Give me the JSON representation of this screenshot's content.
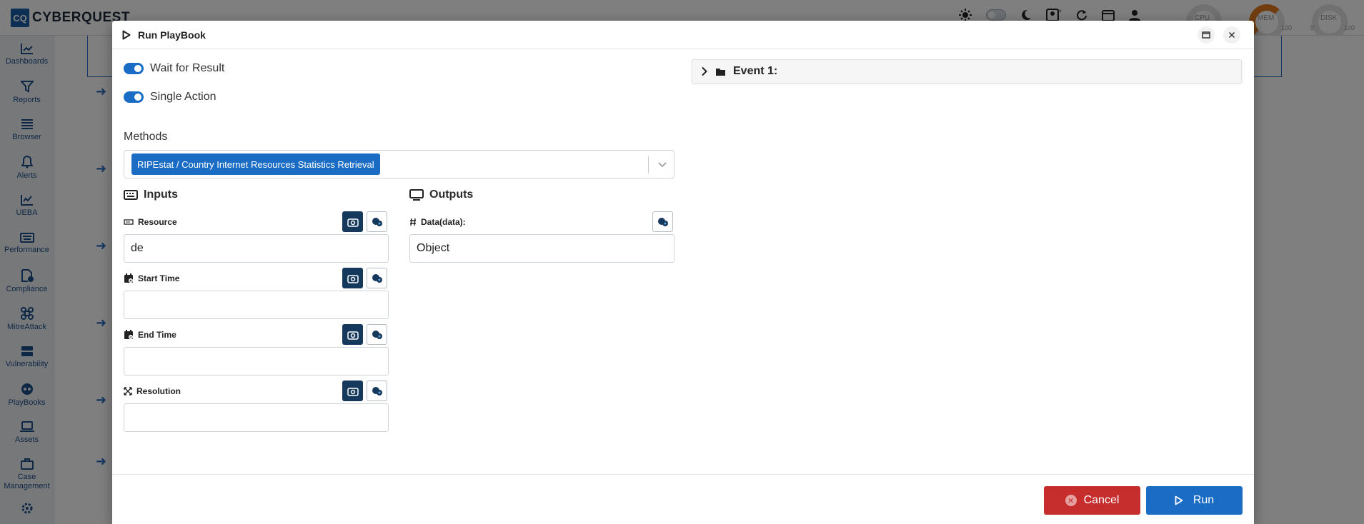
{
  "app": {
    "logo_short": "CQ",
    "logo_text": "CYBERQUEST"
  },
  "gauges": [
    {
      "label": "CPU",
      "min": "",
      "max": ""
    },
    {
      "label": "MEM",
      "min": "",
      "max": "100"
    },
    {
      "label": "DISK",
      "min": "0",
      "max": "100"
    }
  ],
  "sidebar": {
    "items": [
      {
        "label": "Dashboards",
        "icon": "dashboards-icon"
      },
      {
        "label": "Reports",
        "icon": "filter-icon"
      },
      {
        "label": "Browser",
        "icon": "list-icon"
      },
      {
        "label": "Alerts",
        "icon": "bell-icon"
      },
      {
        "label": "UEBA",
        "icon": "chart-line-icon"
      },
      {
        "label": "Performance",
        "icon": "keyboard-icon"
      },
      {
        "label": "Compliance",
        "icon": "file-check-icon"
      },
      {
        "label": "MitreAttack",
        "icon": "command-icon"
      },
      {
        "label": "Vulnerability",
        "icon": "server-icon"
      },
      {
        "label": "PlayBooks",
        "icon": "playbook-icon"
      },
      {
        "label": "Assets",
        "icon": "laptop-icon"
      },
      {
        "label": "Case Management",
        "icon": "briefcase-icon"
      }
    ]
  },
  "modal": {
    "title": "Run PlayBook",
    "toggles": [
      {
        "label": "Wait for Result",
        "on": true
      },
      {
        "label": "Single Action",
        "on": true
      }
    ],
    "methods_label": "Methods",
    "selected_method": "RIPEstat / Country Internet Resources Statistics Retrieval",
    "inputs_title": "Inputs",
    "outputs_title": "Outputs",
    "inputs": [
      {
        "label": "Resource",
        "value": "de",
        "icon": "input-field-icon"
      },
      {
        "label": "Start Time",
        "value": "",
        "icon": "calendar-plus-icon"
      },
      {
        "label": "End Time",
        "value": "",
        "icon": "calendar-minus-icon"
      },
      {
        "label": "Resolution",
        "value": "",
        "icon": "expand-icon"
      }
    ],
    "outputs": [
      {
        "label": "Data(data):",
        "value": "Object",
        "icon": "hash-icon"
      }
    ],
    "event_title": "Event 1:",
    "cancel_label": "Cancel",
    "run_label": "Run"
  },
  "colors": {
    "primary": "#1a6cc4",
    "dark_button": "#15385d",
    "danger": "#c62e2e"
  }
}
